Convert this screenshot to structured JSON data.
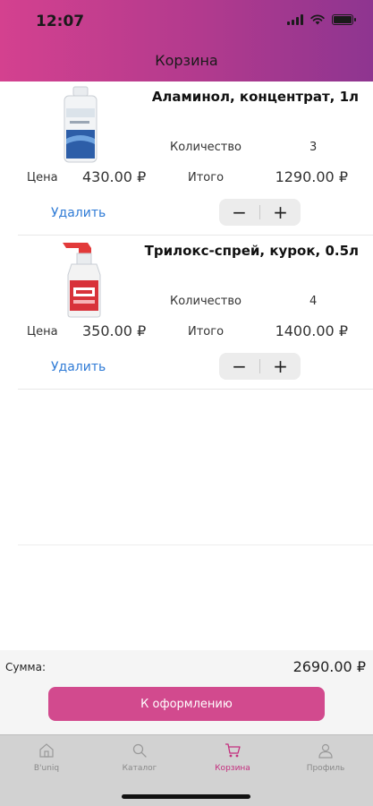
{
  "status_bar": {
    "time": "12:07"
  },
  "nav": {
    "title": "Корзина"
  },
  "labels": {
    "quantity": "Количество",
    "price": "Цена",
    "total": "Итого",
    "delete": "Удалить",
    "minus": "−",
    "plus": "+"
  },
  "items": [
    {
      "name": "Аламинол, концентрат, 1л",
      "quantity": "3",
      "price": "430.00 ₽",
      "total": "1290.00 ₽"
    },
    {
      "name": "Трилокс-спрей, курок, 0.5л",
      "quantity": "4",
      "price": "350.00 ₽",
      "total": "1400.00 ₽"
    }
  ],
  "summary": {
    "label": "Сумма:",
    "value": "2690.00 ₽",
    "checkout_label": "К оформлению"
  },
  "tabs": [
    {
      "label": "B'uniq",
      "icon": "home-icon",
      "active": false
    },
    {
      "label": "Каталог",
      "icon": "search-icon",
      "active": false
    },
    {
      "label": "Корзина",
      "icon": "cart-icon",
      "active": true
    },
    {
      "label": "Профиль",
      "icon": "profile-icon",
      "active": false
    }
  ],
  "colors": {
    "header_gradient": [
      "#d4418f",
      "#8e3590"
    ],
    "accent": "#d24a8e",
    "link": "#2f7bd6",
    "active_tab": "#c4307f"
  }
}
